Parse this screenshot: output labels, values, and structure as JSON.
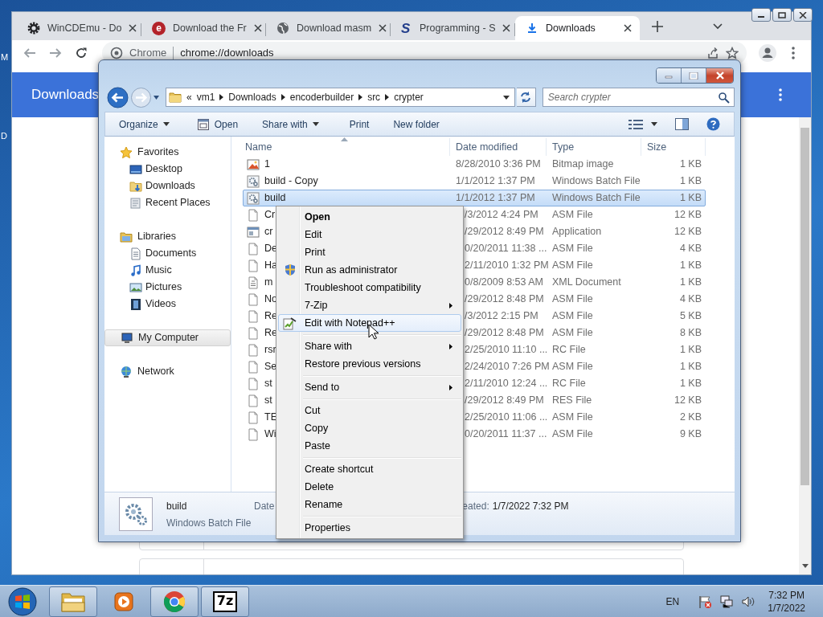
{
  "desktop": {
    "labels": [
      "M",
      "D"
    ]
  },
  "browser": {
    "tabs": [
      {
        "title": "WinCDEmu - Do",
        "kind": "gear",
        "selected": false
      },
      {
        "title": "Download the Fr",
        "kind": "logo-e",
        "logo": "e",
        "selected": false
      },
      {
        "title": "Download masm",
        "kind": "globe",
        "selected": false
      },
      {
        "title": "Programming - S",
        "kind": "logo-s",
        "logo": "S",
        "selected": false
      },
      {
        "title": "Downloads",
        "kind": "download",
        "selected": true
      }
    ],
    "omnibox": {
      "site_label": "Chrome",
      "url": "chrome://downloads"
    },
    "page_title": "Downloads"
  },
  "explorer": {
    "breadcrumb": {
      "overflow": "«",
      "parts": [
        "vm1",
        "Downloads",
        "encoderbuilder",
        "src",
        "crypter"
      ]
    },
    "search": {
      "placeholder": "Search crypter"
    },
    "toolbar": [
      {
        "label": "Organize",
        "kind": "menu"
      },
      {
        "label": "Open",
        "kind": "icon"
      },
      {
        "label": "Share with",
        "kind": "menu"
      },
      {
        "label": "Print",
        "kind": "plain"
      },
      {
        "label": "New folder",
        "kind": "plain"
      }
    ],
    "nav": [
      {
        "label": "Favorites",
        "kind": "star",
        "selected": false,
        "children": [
          {
            "label": "Desktop",
            "kind": "desktop",
            "selected": false
          },
          {
            "label": "Downloads",
            "kind": "dlfolder",
            "selected": false
          },
          {
            "label": "Recent Places",
            "kind": "recent",
            "selected": false
          }
        ]
      },
      {
        "label": "Libraries",
        "kind": "library",
        "selected": false,
        "children": [
          {
            "label": "Documents",
            "kind": "documents",
            "selected": false
          },
          {
            "label": "Music",
            "kind": "music",
            "selected": false
          },
          {
            "label": "Pictures",
            "kind": "pictures",
            "selected": false
          },
          {
            "label": "Videos",
            "kind": "videos",
            "selected": false
          }
        ]
      },
      {
        "label": "My Computer",
        "kind": "computer",
        "selected": true
      },
      {
        "label": "Network",
        "kind": "network",
        "selected": false
      }
    ],
    "columns": [
      "Name",
      "Date modified",
      "Type",
      "Size"
    ],
    "files": [
      {
        "name": "1",
        "date": "8/28/2010 3:36 PM",
        "type": "Bitmap image",
        "size": "1 KB",
        "kind": "bitmap",
        "selected": false
      },
      {
        "name": "build - Copy",
        "date": "1/1/2012 1:37 PM",
        "type": "Windows Batch File",
        "size": "1 KB",
        "kind": "batch",
        "selected": false
      },
      {
        "name": "build",
        "date": "1/1/2012 1:37 PM",
        "type": "Windows Batch File",
        "size": "1 KB",
        "kind": "batch",
        "selected": true
      },
      {
        "name": "Cr",
        "date": "/3/2012 4:24 PM",
        "type": "ASM File",
        "size": "12 KB",
        "kind": "blank",
        "selected": false
      },
      {
        "name": "cr",
        "date": "/29/2012 8:49 PM",
        "type": "Application",
        "size": "12 KB",
        "kind": "app",
        "selected": false
      },
      {
        "name": "De",
        "date": "0/20/2011 11:38 ...",
        "type": "ASM File",
        "size": "4 KB",
        "kind": "blank",
        "selected": false
      },
      {
        "name": "Ha",
        "date": "2/11/2010 1:32 PM",
        "type": "ASM File",
        "size": "1 KB",
        "kind": "blank",
        "selected": false
      },
      {
        "name": "m",
        "date": "0/8/2009 8:53 AM",
        "type": "XML Document",
        "size": "1 KB",
        "kind": "xml",
        "selected": false
      },
      {
        "name": "No",
        "date": "/29/2012 8:48 PM",
        "type": "ASM File",
        "size": "4 KB",
        "kind": "blank",
        "selected": false
      },
      {
        "name": "Re",
        "date": "/3/2012 2:15 PM",
        "type": "ASM File",
        "size": "5 KB",
        "kind": "blank",
        "selected": false
      },
      {
        "name": "Re",
        "date": "/29/2012 8:48 PM",
        "type": "ASM File",
        "size": "8 KB",
        "kind": "blank",
        "selected": false
      },
      {
        "name": "rsr",
        "date": "2/25/2010 11:10 ...",
        "type": "RC File",
        "size": "1 KB",
        "kind": "blank",
        "selected": false
      },
      {
        "name": "Se",
        "date": "2/24/2010 7:26 PM",
        "type": "ASM File",
        "size": "1 KB",
        "kind": "blank",
        "selected": false
      },
      {
        "name": "st",
        "date": "2/11/2010 12:24 ...",
        "type": "RC File",
        "size": "1 KB",
        "kind": "blank",
        "selected": false
      },
      {
        "name": "st",
        "date": "/29/2012 8:49 PM",
        "type": "RES File",
        "size": "12 KB",
        "kind": "blank",
        "selected": false
      },
      {
        "name": "TE",
        "date": "2/25/2010 11:06 ...",
        "type": "ASM File",
        "size": "2 KB",
        "kind": "blank",
        "selected": false
      },
      {
        "name": "Wi",
        "date": "0/20/2011 11:37 ...",
        "type": "ASM File",
        "size": "9 KB",
        "kind": "blank",
        "selected": false
      }
    ],
    "details": {
      "name": "build",
      "type": "Windows Batch File",
      "date_label_start": "Date",
      "date_label_end": "eated:",
      "date_value": "1/7/2022 7:32 PM"
    }
  },
  "context_menu": {
    "items": [
      {
        "kind": "item",
        "label": "Open",
        "default": true,
        "submenu": false,
        "selected": false
      },
      {
        "kind": "item",
        "label": "Edit",
        "default": false,
        "submenu": false,
        "selected": false
      },
      {
        "kind": "item",
        "label": "Print",
        "default": false,
        "submenu": false,
        "selected": false
      },
      {
        "kind": "shield-item",
        "label": "Run as administrator",
        "default": false,
        "submenu": false,
        "selected": false
      },
      {
        "kind": "item",
        "label": "Troubleshoot compatibility",
        "default": false,
        "submenu": false,
        "selected": false
      },
      {
        "kind": "item",
        "label": "7-Zip",
        "default": false,
        "submenu": true,
        "selected": false
      },
      {
        "kind": "notepad-item",
        "label": "Edit with Notepad++",
        "default": false,
        "submenu": false,
        "selected": true
      },
      {
        "kind": "separator"
      },
      {
        "kind": "item",
        "label": "Share with",
        "default": false,
        "submenu": true,
        "selected": false
      },
      {
        "kind": "item",
        "label": "Restore previous versions",
        "default": false,
        "submenu": false,
        "selected": false
      },
      {
        "kind": "separator"
      },
      {
        "kind": "item",
        "label": "Send to",
        "default": false,
        "submenu": true,
        "selected": false
      },
      {
        "kind": "separator"
      },
      {
        "kind": "item",
        "label": "Cut",
        "default": false,
        "submenu": false,
        "selected": false
      },
      {
        "kind": "item",
        "label": "Copy",
        "default": false,
        "submenu": false,
        "selected": false
      },
      {
        "kind": "item",
        "label": "Paste",
        "default": false,
        "submenu": false,
        "selected": false
      },
      {
        "kind": "separator"
      },
      {
        "kind": "item",
        "label": "Create shortcut",
        "default": false,
        "submenu": false,
        "selected": false
      },
      {
        "kind": "item",
        "label": "Delete",
        "default": false,
        "submenu": false,
        "selected": false
      },
      {
        "kind": "item",
        "label": "Rename",
        "default": false,
        "submenu": false,
        "selected": false
      },
      {
        "kind": "separator"
      },
      {
        "kind": "item",
        "label": "Properties",
        "default": false,
        "submenu": false,
        "selected": false
      }
    ]
  },
  "taskbar": {
    "buttons": [
      {
        "kind": "explorer",
        "running": true
      },
      {
        "kind": "media",
        "running": false
      },
      {
        "kind": "chrome",
        "running": true
      },
      {
        "kind": "sevenzip",
        "label": "7z",
        "running": true
      }
    ],
    "tray": {
      "language": "EN",
      "time": "7:32 PM",
      "date": "1/7/2022"
    }
  }
}
